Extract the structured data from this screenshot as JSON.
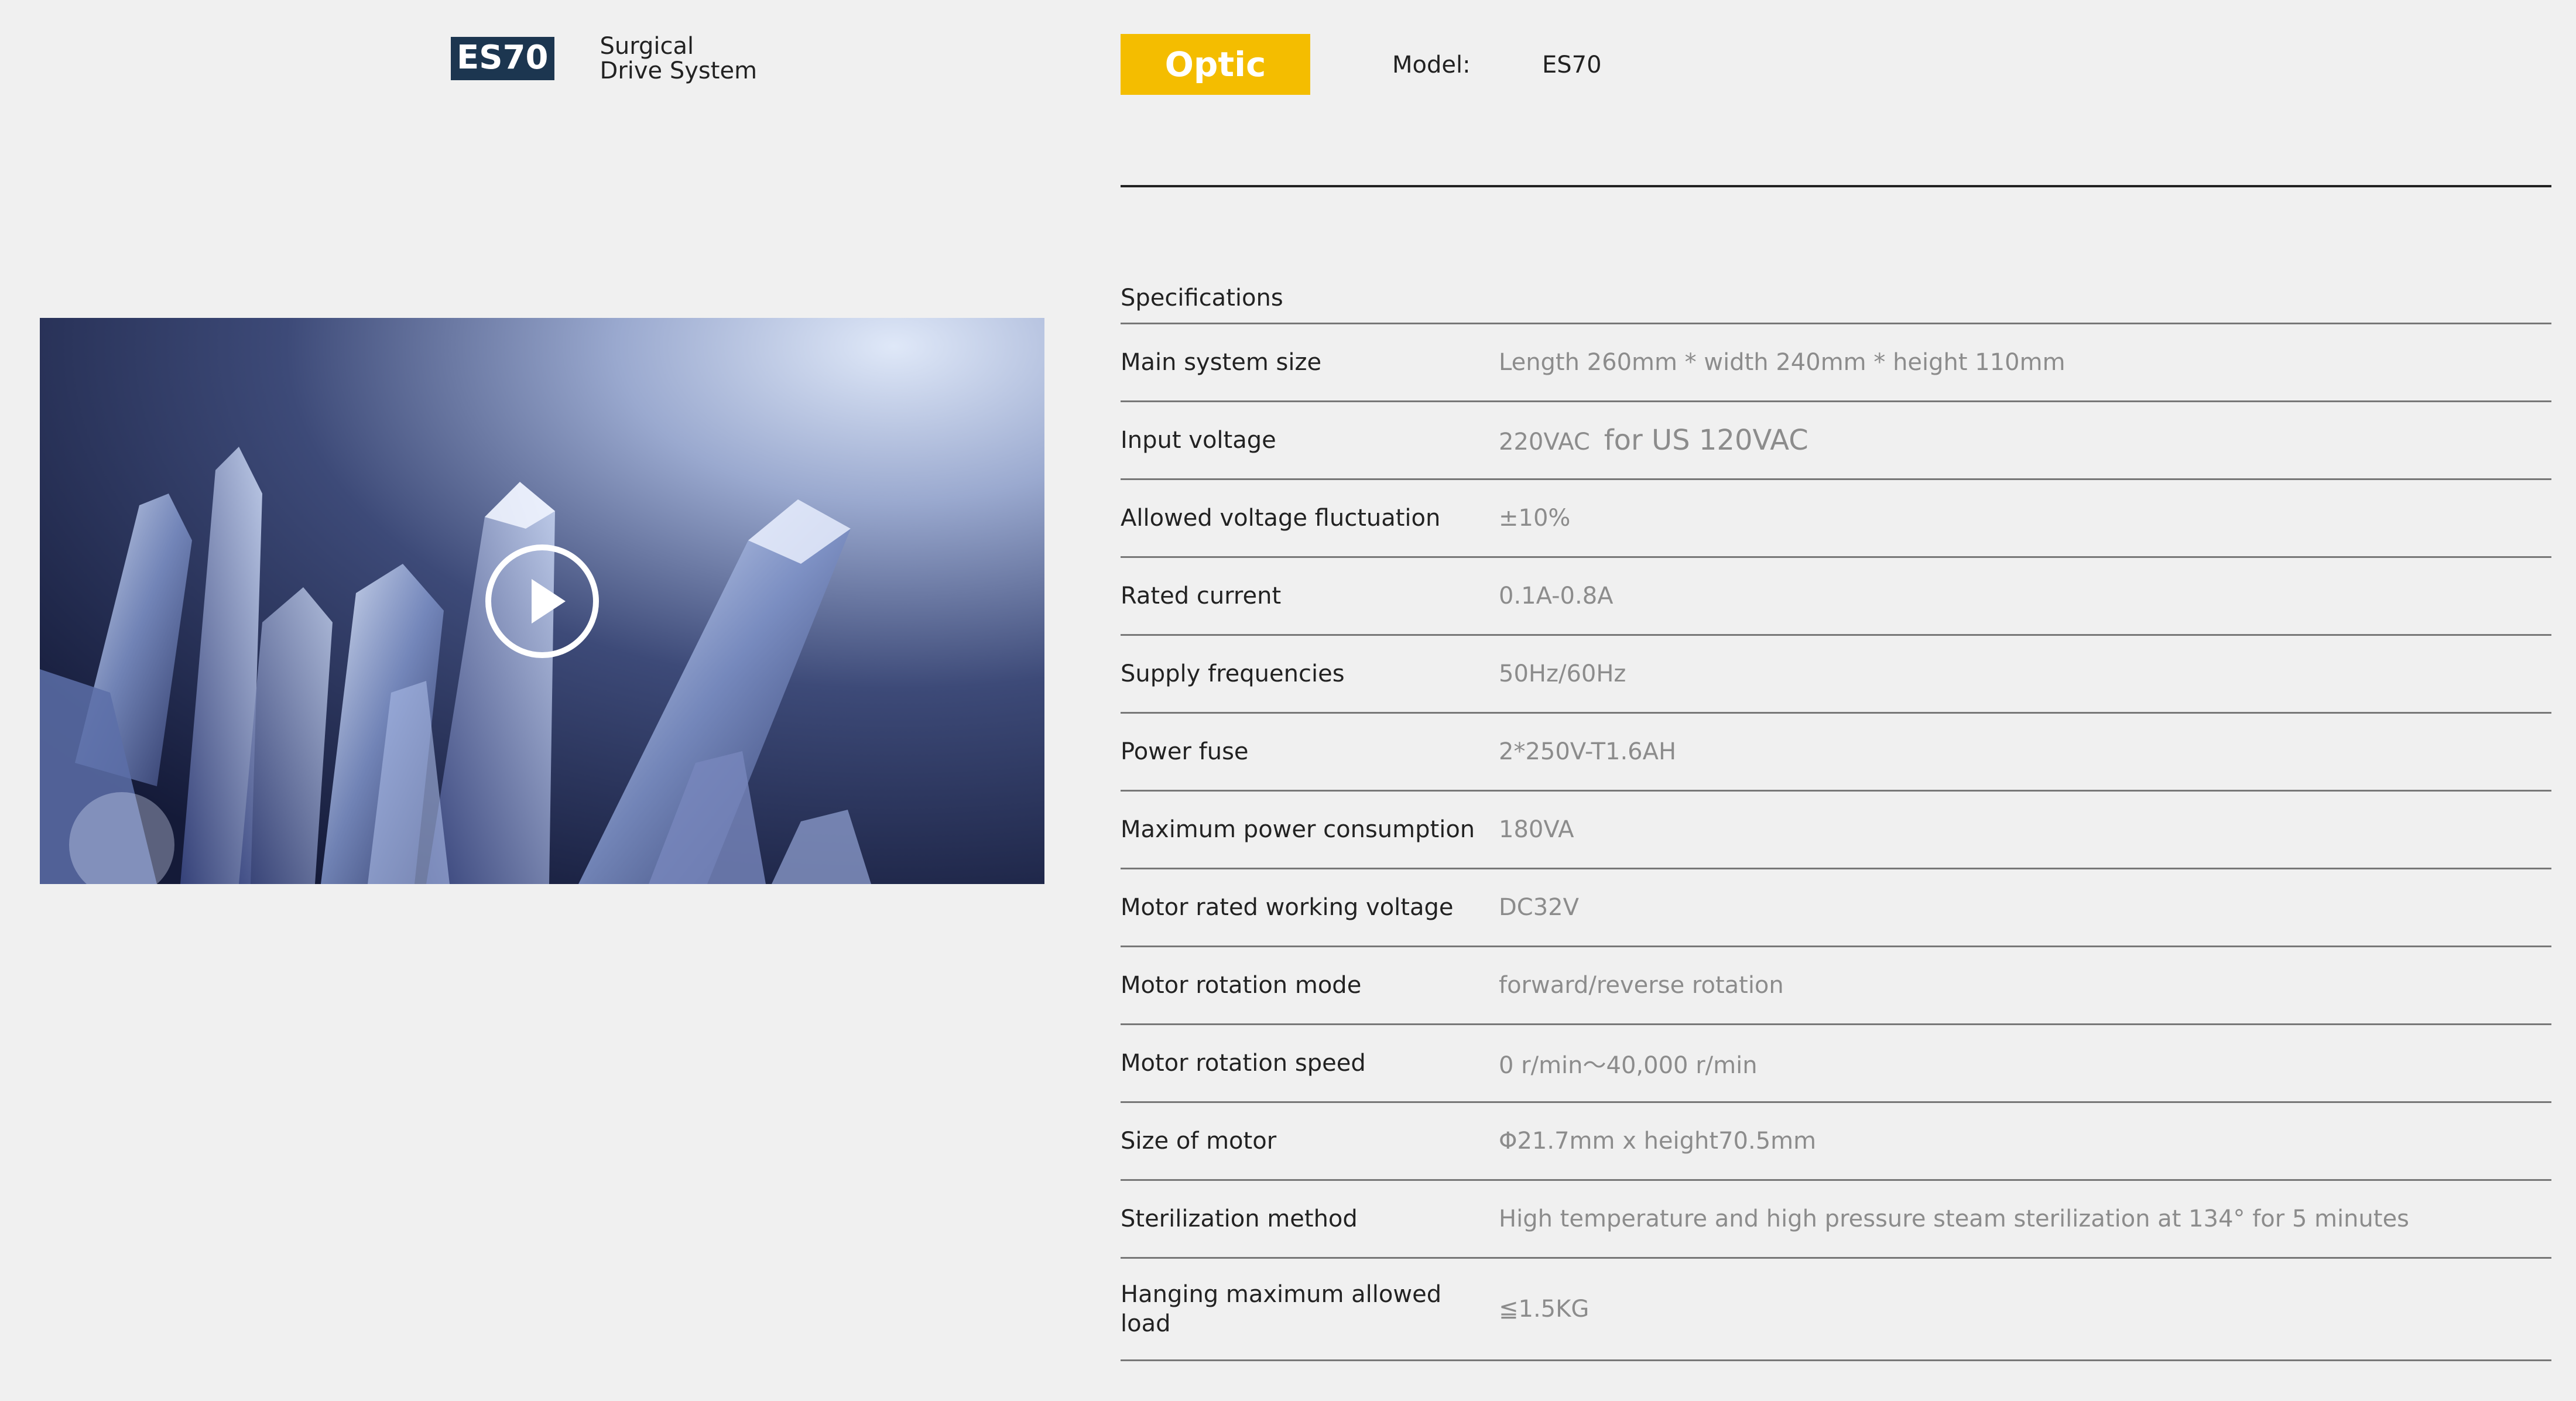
{
  "brand": {
    "badge": "ES70",
    "subtitle_line1": "Surgical",
    "subtitle_line2": "Drive System"
  },
  "header": {
    "badge": "Optic",
    "model_label": "Model:",
    "model_value": "ES70",
    "accent_color": "#f4bd00",
    "brand_color": "#1c3650"
  },
  "video": {
    "play_icon": "play-circle-icon"
  },
  "specs": {
    "title": "Specifications",
    "rows": [
      {
        "label": "Main system size",
        "value": "Length 260mm * width 240mm * height 110mm",
        "note": ""
      },
      {
        "label": "Input voltage",
        "value": "220VAC",
        "note": "for US 120VAC"
      },
      {
        "label": "Allowed voltage fluctuation",
        "value": "±10%",
        "note": ""
      },
      {
        "label": "Rated current",
        "value": "0.1A-0.8A",
        "note": ""
      },
      {
        "label": "Supply frequencies",
        "value": "50Hz/60Hz",
        "note": ""
      },
      {
        "label": "Power fuse",
        "value": "2*250V-T1.6AH",
        "note": ""
      },
      {
        "label": "Maximum power consumption",
        "value": "180VA",
        "note": ""
      },
      {
        "label": "Motor rated working voltage",
        "value": "DC32V",
        "note": ""
      },
      {
        "label": "Motor rotation mode",
        "value": "forward/reverse rotation",
        "note": ""
      },
      {
        "label": "Motor rotation speed",
        "value": "0 r/min～40,000 r/min",
        "note": ""
      },
      {
        "label": "Size of motor",
        "value": "Φ21.7mm x height70.5mm",
        "note": ""
      },
      {
        "label": "Sterilization method",
        "value": "High temperature and high pressure steam sterilization at 134° for 5 minutes",
        "note": ""
      },
      {
        "label": "Hanging maximum allowed load",
        "value": "≦1.5KG",
        "note": ""
      }
    ]
  }
}
